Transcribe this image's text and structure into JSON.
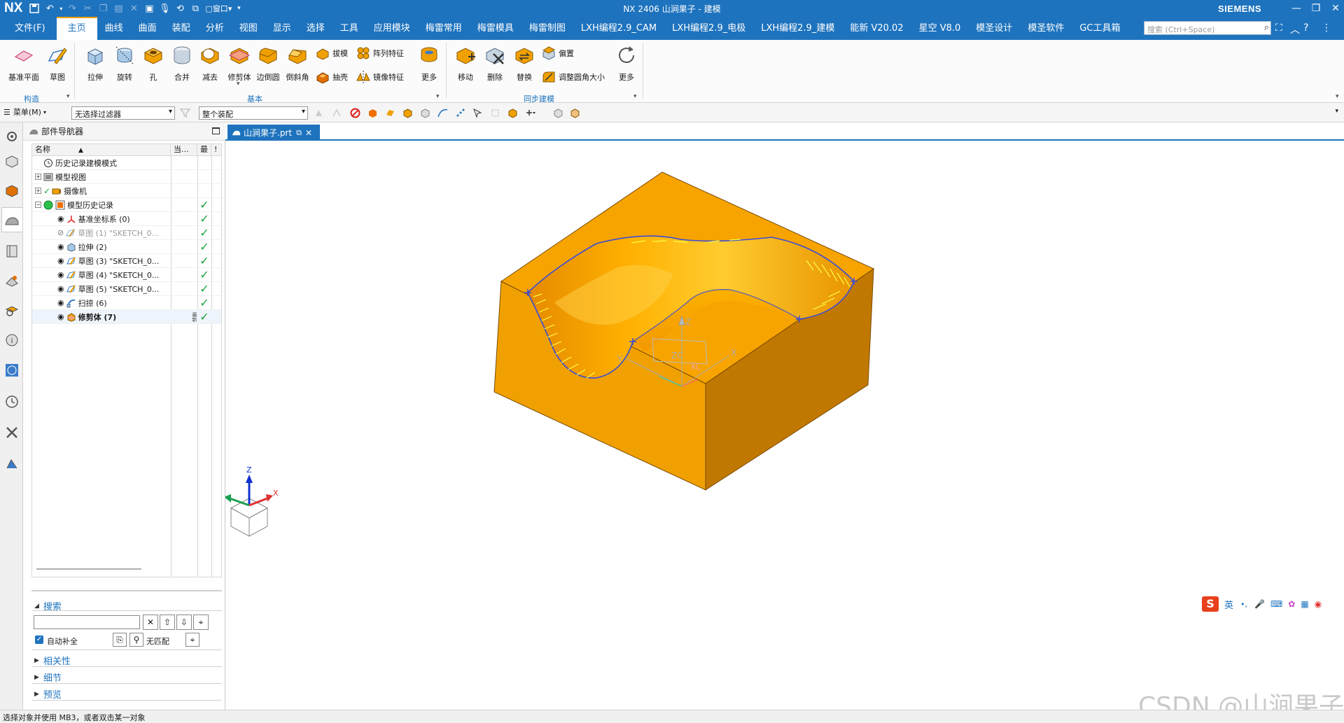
{
  "app": {
    "logo": "NX",
    "title": "NX 2406 山涧果子 - 建模",
    "brand": "SIEMENS",
    "quick_window_label": "窗口"
  },
  "menu": {
    "items": [
      "文件(F)",
      "主页",
      "曲线",
      "曲面",
      "装配",
      "分析",
      "视图",
      "显示",
      "选择",
      "工具",
      "应用模块",
      "梅雷常用",
      "梅雷模具",
      "梅雷制图",
      "LXH编程2.9_CAM",
      "LXH编程2.9_电极",
      "LXH编程2.9_建模",
      "能新 V20.02",
      "星空 V8.0",
      "模圣设计",
      "模圣软件",
      "GC工具箱"
    ],
    "active": "主页",
    "search_placeholder": "搜索 (Ctrl+Space)"
  },
  "ribbon": {
    "construct": {
      "label": "构造",
      "buttons": [
        "基准平面",
        "草图"
      ]
    },
    "basic": {
      "label": "基本",
      "buttons": [
        "拉伸",
        "旋转",
        "孔",
        "合并",
        "减去",
        "修剪体",
        "边倒圆",
        "倒斜角"
      ],
      "small": [
        "拔模",
        "阵列特征",
        "抽壳",
        "镜像特征"
      ],
      "more": "更多"
    },
    "sync": {
      "label": "同步建模",
      "buttons": [
        "移动",
        "删除",
        "替换"
      ],
      "small": [
        "偏置",
        "调整圆角大小"
      ],
      "more": "更多"
    }
  },
  "selection_bar": {
    "menu_label": "菜单(M)",
    "filter": "无选择过滤器",
    "scope": "整个装配"
  },
  "navigator": {
    "title": "部件导航器",
    "columns": [
      "名称",
      "当...",
      "最",
      "!"
    ],
    "rows": [
      {
        "label": "历史记录建模模式",
        "indent": 0,
        "expander": "",
        "icon": "history-mode-icon",
        "check": ""
      },
      {
        "label": "模型视图",
        "indent": 0,
        "expander": "+",
        "icon": "model-view-icon",
        "check": ""
      },
      {
        "label": "摄像机",
        "indent": 0,
        "expander": "+",
        "icon": "camera-icon",
        "check": ""
      },
      {
        "label": "模型历史记录",
        "indent": 0,
        "expander": "-",
        "icon": "model-history-icon",
        "check": "✓"
      },
      {
        "label": "基准坐标系 (0)",
        "indent": 1,
        "icon": "datum-csys-icon",
        "check": "✓"
      },
      {
        "label": "草图 (1) \"SKETCH_0...",
        "indent": 1,
        "icon": "sketch-icon",
        "check": "✓",
        "hidden": true
      },
      {
        "label": "拉伸 (2)",
        "indent": 1,
        "icon": "extrude-icon",
        "check": "✓"
      },
      {
        "label": "草图 (3) \"SKETCH_0...",
        "indent": 1,
        "icon": "sketch-icon",
        "check": "✓"
      },
      {
        "label": "草图 (4) \"SKETCH_0...",
        "indent": 1,
        "icon": "sketch-icon",
        "check": "✓"
      },
      {
        "label": "草图 (5) \"SKETCH_0...",
        "indent": 1,
        "icon": "sketch-icon",
        "check": "✓"
      },
      {
        "label": "扫掠 (6)",
        "indent": 1,
        "icon": "sweep-icon",
        "check": "✓"
      },
      {
        "label": "修剪体 (7)",
        "indent": 1,
        "icon": "trim-body-icon",
        "check": "✓",
        "bold": true,
        "current": "最新"
      }
    ],
    "search": {
      "label": "搜索",
      "autocomplete": "自动补全",
      "no_match": "无匹配"
    },
    "sections": [
      "相关性",
      "细节",
      "预览"
    ]
  },
  "document": {
    "tab": "山涧果子.prt"
  },
  "triad": {
    "x": "X",
    "y": "Y",
    "z": "Z"
  },
  "wcs": {
    "zc": "ZC",
    "xc": "XC",
    "yc": "Y",
    "x": "X",
    "z": "Z"
  },
  "ime": {
    "lang": "英"
  },
  "watermark": "CSDN @山涧果子",
  "status": "选择对象并使用 MB3，或者双击某一对象",
  "colors": {
    "accent": "#1e73be",
    "part": "#f0a000",
    "part_dark": "#c17800",
    "part_top": "#f7a400",
    "check": "#19a33c"
  }
}
